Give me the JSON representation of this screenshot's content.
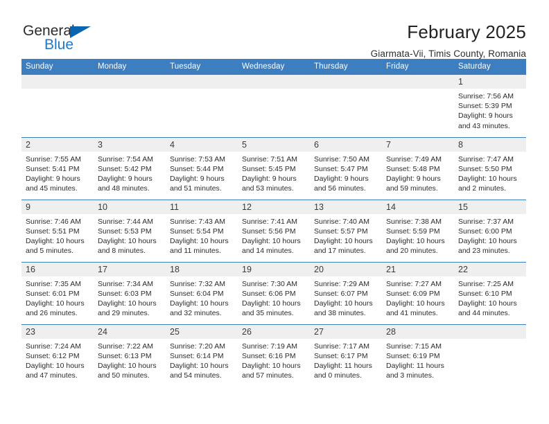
{
  "brand": {
    "name_top": "General",
    "name_bottom": "Blue",
    "triangle_color": "#0b64b0",
    "blue_text_color": "#2079c7"
  },
  "header": {
    "title": "February 2025",
    "location": "Giarmata-Vii, Timis County, Romania"
  },
  "theme": {
    "header_row_bg": "#3c7ebf",
    "header_row_text": "#ffffff",
    "daynum_bg": "#efefef",
    "row_separator": "#3c7ebf"
  },
  "calendar": {
    "weekday_headers": [
      "Sunday",
      "Monday",
      "Tuesday",
      "Wednesday",
      "Thursday",
      "Friday",
      "Saturday"
    ],
    "labels": {
      "sunrise": "Sunrise:",
      "sunset": "Sunset:",
      "daylight": "Daylight:"
    },
    "weeks": [
      [
        {
          "day": "",
          "empty": true
        },
        {
          "day": "",
          "empty": true
        },
        {
          "day": "",
          "empty": true
        },
        {
          "day": "",
          "empty": true
        },
        {
          "day": "",
          "empty": true
        },
        {
          "day": "",
          "empty": true
        },
        {
          "day": "1",
          "sunrise": "Sunrise: 7:56 AM",
          "sunset": "Sunset: 5:39 PM",
          "daylight": "Daylight: 9 hours and 43 minutes."
        }
      ],
      [
        {
          "day": "2",
          "sunrise": "Sunrise: 7:55 AM",
          "sunset": "Sunset: 5:41 PM",
          "daylight": "Daylight: 9 hours and 45 minutes."
        },
        {
          "day": "3",
          "sunrise": "Sunrise: 7:54 AM",
          "sunset": "Sunset: 5:42 PM",
          "daylight": "Daylight: 9 hours and 48 minutes."
        },
        {
          "day": "4",
          "sunrise": "Sunrise: 7:53 AM",
          "sunset": "Sunset: 5:44 PM",
          "daylight": "Daylight: 9 hours and 51 minutes."
        },
        {
          "day": "5",
          "sunrise": "Sunrise: 7:51 AM",
          "sunset": "Sunset: 5:45 PM",
          "daylight": "Daylight: 9 hours and 53 minutes."
        },
        {
          "day": "6",
          "sunrise": "Sunrise: 7:50 AM",
          "sunset": "Sunset: 5:47 PM",
          "daylight": "Daylight: 9 hours and 56 minutes."
        },
        {
          "day": "7",
          "sunrise": "Sunrise: 7:49 AM",
          "sunset": "Sunset: 5:48 PM",
          "daylight": "Daylight: 9 hours and 59 minutes."
        },
        {
          "day": "8",
          "sunrise": "Sunrise: 7:47 AM",
          "sunset": "Sunset: 5:50 PM",
          "daylight": "Daylight: 10 hours and 2 minutes."
        }
      ],
      [
        {
          "day": "9",
          "sunrise": "Sunrise: 7:46 AM",
          "sunset": "Sunset: 5:51 PM",
          "daylight": "Daylight: 10 hours and 5 minutes."
        },
        {
          "day": "10",
          "sunrise": "Sunrise: 7:44 AM",
          "sunset": "Sunset: 5:53 PM",
          "daylight": "Daylight: 10 hours and 8 minutes."
        },
        {
          "day": "11",
          "sunrise": "Sunrise: 7:43 AM",
          "sunset": "Sunset: 5:54 PM",
          "daylight": "Daylight: 10 hours and 11 minutes."
        },
        {
          "day": "12",
          "sunrise": "Sunrise: 7:41 AM",
          "sunset": "Sunset: 5:56 PM",
          "daylight": "Daylight: 10 hours and 14 minutes."
        },
        {
          "day": "13",
          "sunrise": "Sunrise: 7:40 AM",
          "sunset": "Sunset: 5:57 PM",
          "daylight": "Daylight: 10 hours and 17 minutes."
        },
        {
          "day": "14",
          "sunrise": "Sunrise: 7:38 AM",
          "sunset": "Sunset: 5:59 PM",
          "daylight": "Daylight: 10 hours and 20 minutes."
        },
        {
          "day": "15",
          "sunrise": "Sunrise: 7:37 AM",
          "sunset": "Sunset: 6:00 PM",
          "daylight": "Daylight: 10 hours and 23 minutes."
        }
      ],
      [
        {
          "day": "16",
          "sunrise": "Sunrise: 7:35 AM",
          "sunset": "Sunset: 6:01 PM",
          "daylight": "Daylight: 10 hours and 26 minutes."
        },
        {
          "day": "17",
          "sunrise": "Sunrise: 7:34 AM",
          "sunset": "Sunset: 6:03 PM",
          "daylight": "Daylight: 10 hours and 29 minutes."
        },
        {
          "day": "18",
          "sunrise": "Sunrise: 7:32 AM",
          "sunset": "Sunset: 6:04 PM",
          "daylight": "Daylight: 10 hours and 32 minutes."
        },
        {
          "day": "19",
          "sunrise": "Sunrise: 7:30 AM",
          "sunset": "Sunset: 6:06 PM",
          "daylight": "Daylight: 10 hours and 35 minutes."
        },
        {
          "day": "20",
          "sunrise": "Sunrise: 7:29 AM",
          "sunset": "Sunset: 6:07 PM",
          "daylight": "Daylight: 10 hours and 38 minutes."
        },
        {
          "day": "21",
          "sunrise": "Sunrise: 7:27 AM",
          "sunset": "Sunset: 6:09 PM",
          "daylight": "Daylight: 10 hours and 41 minutes."
        },
        {
          "day": "22",
          "sunrise": "Sunrise: 7:25 AM",
          "sunset": "Sunset: 6:10 PM",
          "daylight": "Daylight: 10 hours and 44 minutes."
        }
      ],
      [
        {
          "day": "23",
          "sunrise": "Sunrise: 7:24 AM",
          "sunset": "Sunset: 6:12 PM",
          "daylight": "Daylight: 10 hours and 47 minutes."
        },
        {
          "day": "24",
          "sunrise": "Sunrise: 7:22 AM",
          "sunset": "Sunset: 6:13 PM",
          "daylight": "Daylight: 10 hours and 50 minutes."
        },
        {
          "day": "25",
          "sunrise": "Sunrise: 7:20 AM",
          "sunset": "Sunset: 6:14 PM",
          "daylight": "Daylight: 10 hours and 54 minutes."
        },
        {
          "day": "26",
          "sunrise": "Sunrise: 7:19 AM",
          "sunset": "Sunset: 6:16 PM",
          "daylight": "Daylight: 10 hours and 57 minutes."
        },
        {
          "day": "27",
          "sunrise": "Sunrise: 7:17 AM",
          "sunset": "Sunset: 6:17 PM",
          "daylight": "Daylight: 11 hours and 0 minutes."
        },
        {
          "day": "28",
          "sunrise": "Sunrise: 7:15 AM",
          "sunset": "Sunset: 6:19 PM",
          "daylight": "Daylight: 11 hours and 3 minutes."
        },
        {
          "day": "",
          "empty": true
        }
      ]
    ]
  }
}
